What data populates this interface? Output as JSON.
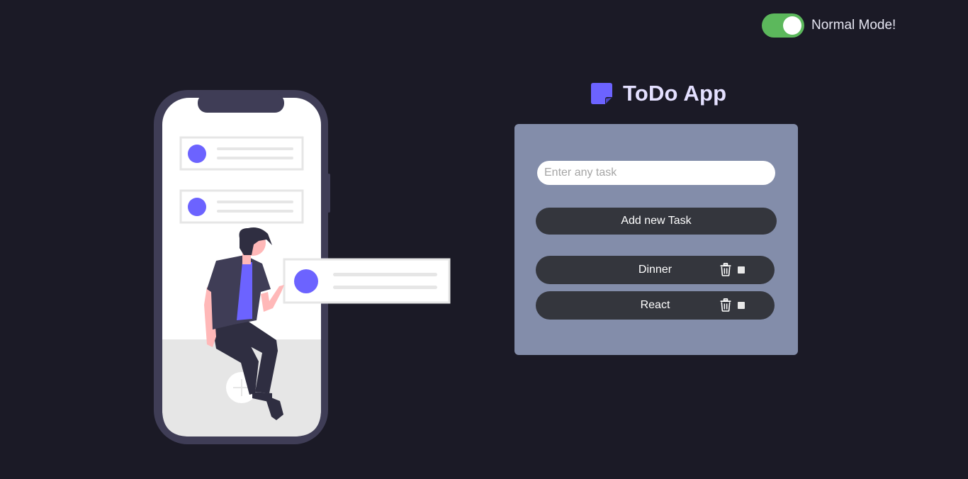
{
  "mode_toggle": {
    "label": "Normal Mode!",
    "state": "on",
    "icon": "toggle-switch-icon",
    "color": "#5cb85c"
  },
  "header": {
    "title": "ToDo App",
    "icon": "sticky-note-icon",
    "icon_color": "#6c63ff"
  },
  "form": {
    "input_placeholder": "Enter any task",
    "input_value": "",
    "add_button_label": "Add new Task"
  },
  "tasks": [
    {
      "name": "Dinner",
      "delete_icon": "trash-icon",
      "completed": false
    },
    {
      "name": "React",
      "delete_icon": "trash-icon",
      "completed": false
    }
  ],
  "colors": {
    "background": "#1b1a26",
    "panel": "#838daa",
    "button": "#34363d",
    "accent": "#6c63ff"
  }
}
